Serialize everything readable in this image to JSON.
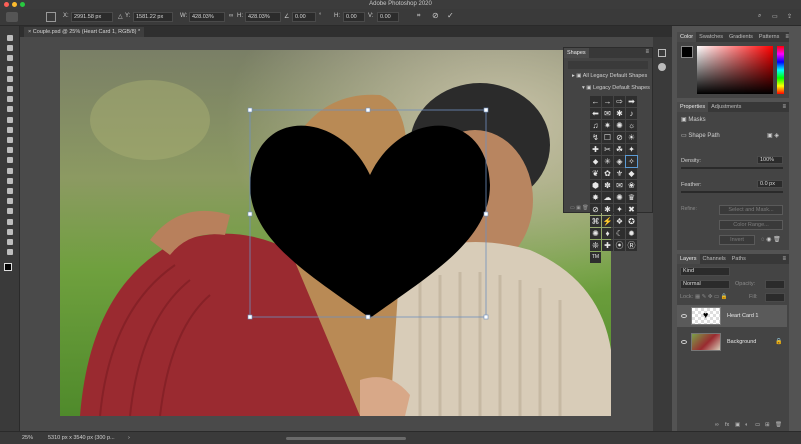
{
  "app": {
    "title": "Adobe Photoshop 2020"
  },
  "options": {
    "x_label": "X:",
    "x_value": "2991.58 px",
    "y_label": "Y:",
    "y_value": "1581.22 px",
    "w_label": "W:",
    "w_value": "428.03%",
    "h_label": "H:",
    "h_value": "428.03%",
    "angle_value": "0.00",
    "hskew_label": "H:",
    "hskew_value": "0.00",
    "vskew_label": "V:",
    "vskew_value": "0.00"
  },
  "document": {
    "tab_label": "Couple.psd @ 25% (Heart Card 1, RGB/8) *"
  },
  "status": {
    "zoom": "25%",
    "doc_info": "5310 px x 3540 px (300 p..."
  },
  "shapes_panel": {
    "title": "Shapes",
    "group_all": "All Legacy Default Shapes",
    "group_legacy": "Legacy Default Shapes",
    "glyphs": [
      "←",
      "→",
      "⇨",
      "➡",
      "⬅",
      "✉",
      "✱",
      "♪",
      "♫",
      "✷",
      "✺",
      "☼",
      "↯",
      "☐",
      "⊘",
      "☀",
      "✚",
      "✂",
      "☘",
      "✦",
      "⬥",
      "✳",
      "◈",
      "✧",
      "❦",
      "✿",
      "⚜",
      "◆",
      "⬢",
      "✽",
      "✉",
      "❀",
      "✸",
      "☁",
      "✺",
      "♛",
      "⊘",
      "✱",
      "✦",
      "✖",
      "⌘",
      "⚡",
      "❖",
      "✪",
      "✺",
      "♦",
      "☾",
      "✹",
      "❊",
      "✚",
      "⦿",
      "Ⓡ",
      "TM"
    ]
  },
  "color_panel": {
    "tabs": [
      "Color",
      "Swatches",
      "Gradients",
      "Patterns"
    ],
    "foreground": "#000000",
    "background": "#ffffff",
    "hue": "#ff0000"
  },
  "properties_panel": {
    "tabs": [
      "Properties",
      "Adjustments"
    ],
    "masks_label": "Masks",
    "shape_path_label": "Shape Path",
    "density_label": "Density:",
    "density_value": "100%",
    "feather_label": "Feather:",
    "feather_value": "0.0 px",
    "refine_label": "Refine:",
    "select_mask_button": "Select and Mask...",
    "color_range_button": "Color Range...",
    "invert_button": "Invert"
  },
  "layers_panel": {
    "tabs": [
      "Layers",
      "Channels",
      "Paths"
    ],
    "kind_label": "Kind",
    "blend_mode": "Normal",
    "opacity_label": "Opacity:",
    "lock_label": "Lock:",
    "fill_label": "Fill:",
    "layers": [
      {
        "name": "Heart Card 1",
        "selected": true
      },
      {
        "name": "Background",
        "selected": false
      }
    ],
    "footer_icons": [
      "link-icon",
      "fx-icon",
      "mask-icon",
      "adjustment-icon",
      "folder-icon",
      "new-layer-icon",
      "trash-icon"
    ]
  },
  "toolbar": {
    "tools": [
      "move-tool-icon",
      "marquee-tool-icon",
      "lasso-tool-icon",
      "quick-select-tool-icon",
      "crop-tool-icon",
      "frame-tool-icon",
      "eyedropper-tool-icon",
      "healing-brush-icon",
      "brush-tool-icon",
      "clone-stamp-icon",
      "history-brush-icon",
      "eraser-tool-icon",
      "gradient-tool-icon",
      "blur-tool-icon",
      "dodge-tool-icon",
      "pen-tool-icon",
      "type-tool-icon",
      "path-select-icon",
      "shape-tool-icon",
      "hand-tool-icon",
      "zoom-tool-icon",
      "more-tools-icon"
    ]
  }
}
